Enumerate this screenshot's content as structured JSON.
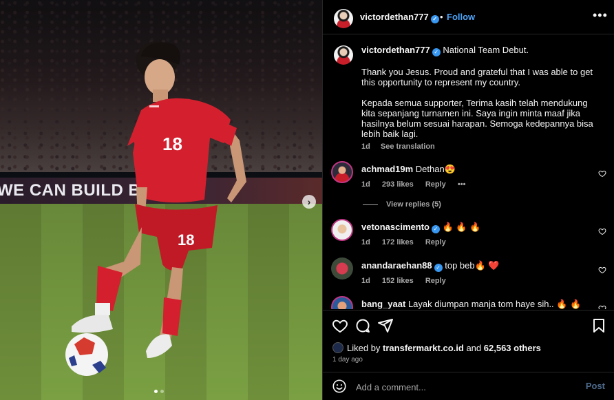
{
  "header": {
    "username": "victordethan777",
    "separator": "•",
    "follow_label": "Follow",
    "more_icon": "more-horizontal-icon"
  },
  "photo": {
    "board_text": "WE CAN BUILD BETTER",
    "jersey_number": "18",
    "carousel_dots": 2,
    "current_slide": 1
  },
  "caption": {
    "username": "victordethan777",
    "title": "National Team Debut.",
    "paragraph1": "Thank you Jesus. Proud and grateful that I was able to get this opportunity to represent my country.",
    "paragraph2": "Kepada semua supporter, Terima kasih telah mendukung kita sepanjang turnamen ini. Saya ingin minta maaf jika hasilnya belum sesuai harapan. Semoga kedepannya bisa lebih baik lagi.",
    "time": "1d",
    "translation_label": "See translation"
  },
  "comments": [
    {
      "username": "achmad19m",
      "verified": false,
      "text": "Dethan😍",
      "time": "1d",
      "likes": "293 likes",
      "reply": "Reply",
      "more": "•••"
    },
    {
      "username": "vetonascimento",
      "verified": true,
      "text": "🔥 🔥 🔥",
      "time": "1d",
      "likes": "172 likes",
      "reply": "Reply"
    },
    {
      "username": "anandaraehan88",
      "verified": true,
      "text": "top beb🔥 ❤️",
      "time": "1d",
      "likes": "152 likes",
      "reply": "Reply"
    },
    {
      "username": "bang_yaat",
      "verified": false,
      "text": "Layak diumpan manja tom haye sih.. 🔥 🔥"
    }
  ],
  "view_replies": "View replies (5)",
  "likes": {
    "prefix": "Liked by",
    "by": "transfermarkt.co.id",
    "middle": "and",
    "others": "62,563 others"
  },
  "date": "1 day ago",
  "comment_box": {
    "placeholder": "Add a comment...",
    "post_label": "Post"
  },
  "colors": {
    "background": "#000000",
    "link_blue": "#4fa3f7",
    "verified": "#3897f0",
    "muted": "#a8a8a8",
    "jersey_red": "#d4202e",
    "post_disabled": "#4d6a8c"
  }
}
